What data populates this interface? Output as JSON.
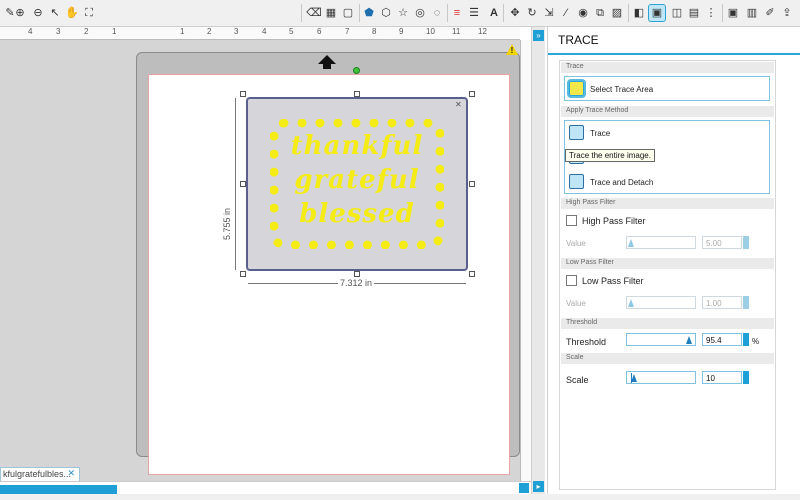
{
  "toolbar": {
    "left_icons": [
      "eraser-icon",
      "zoom-in-icon",
      "zoom-out-icon",
      "select-icon",
      "pan-icon",
      "fit-icon"
    ],
    "right_icons": [
      "eraser-tool-icon",
      "grid-icon",
      "page-icon",
      "shape-pentagon-icon",
      "shape-hexagon-icon",
      "shape-star-icon",
      "shape-spiral-icon",
      "shape-ring-icon",
      "color-lines-icon",
      "line-weight-icon",
      "text-icon",
      "move-icon",
      "rotate-icon",
      "scale-icon",
      "knife-icon",
      "offset-icon",
      "replicate-icon",
      "fill-icon",
      "trace-icon",
      "library-icon",
      "mirror-icon",
      "send-icon",
      "design-page-icon",
      "cut-settings-icon",
      "store-icon"
    ]
  },
  "ruler": {
    "ticks": [
      "4",
      "3",
      "2",
      "1",
      "",
      "1",
      "2",
      "3",
      "4",
      "5",
      "6",
      "7",
      "8",
      "9",
      "10",
      "11",
      "12"
    ]
  },
  "canvas": {
    "design_text": [
      "thankful",
      "grateful",
      "blessed"
    ],
    "height_label": "5.755 in",
    "width_label": "7.312 in"
  },
  "document": {
    "tab_label": "kfulgratefulbles..."
  },
  "panel": {
    "title": "TRACE",
    "sections": {
      "trace": "Trace",
      "apply_method": "Apply Trace Method",
      "high_pass": "High Pass Filter",
      "low_pass": "Low Pass Filter",
      "threshold": "Threshold",
      "scale": "Scale"
    },
    "select_trace_area": "Select Trace Area",
    "method_trace": "Trace",
    "method_trace_detach": "Trace and Detach",
    "tooltip": "Trace the entire image.",
    "high_pass_check_label": "High Pass Filter",
    "high_pass_value_label": "Value",
    "high_pass_value": "5.00",
    "low_pass_check_label": "Low Pass Filter",
    "low_pass_value_label": "Value",
    "low_pass_value": "1.00",
    "threshold_label": "Threshold",
    "threshold_value": "95.4",
    "threshold_unit": "%",
    "scale_label": "Scale",
    "scale_value": "10"
  },
  "colors": {
    "accent": "#1e9fd6",
    "design_fill": "#f4ec14",
    "mat": "#bdbdbd"
  }
}
